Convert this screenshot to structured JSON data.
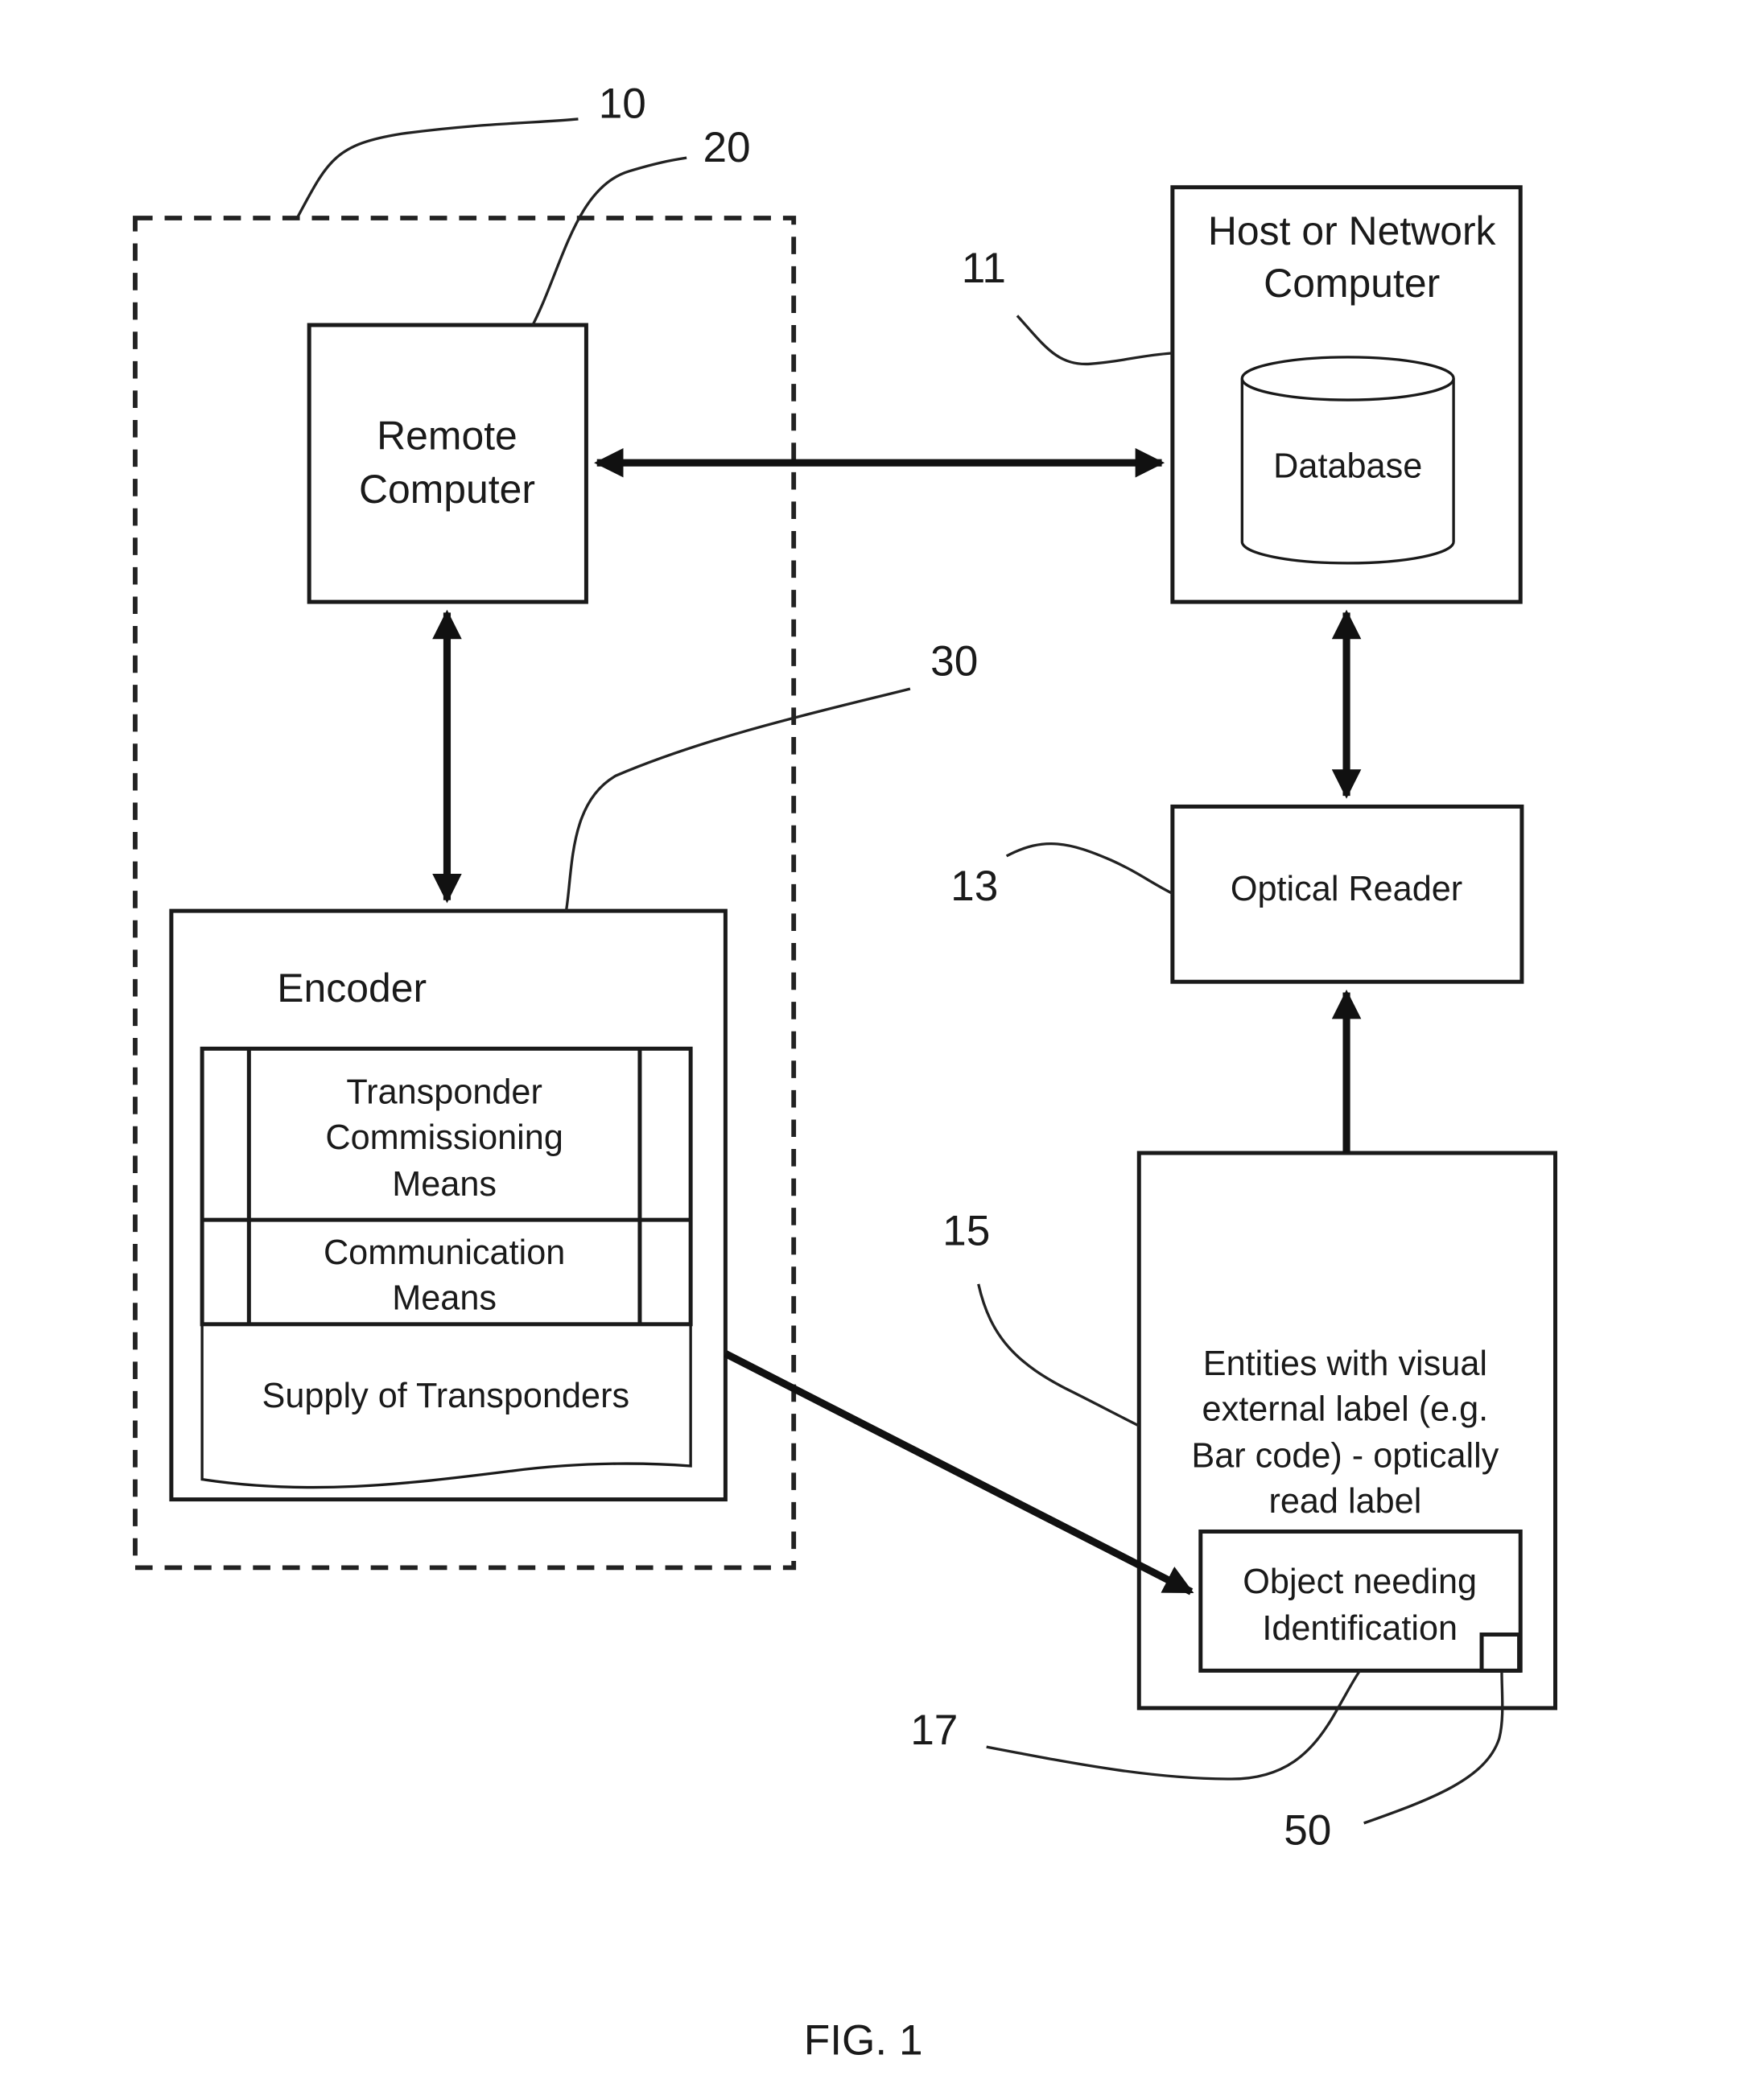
{
  "figure": {
    "caption": "FIG. 1",
    "reference_numerals": {
      "system": "10",
      "remote_computer": "20",
      "host": "11",
      "encoder": "30",
      "optical_reader": "13",
      "entities": "15",
      "object": "17",
      "transponder": "50"
    },
    "blocks": {
      "remote_computer": [
        "Remote",
        "Computer"
      ],
      "host": [
        "Host or Network",
        "Computer"
      ],
      "database": "Database",
      "optical_reader": "Optical Reader",
      "encoder": "Encoder",
      "transponder_commissioning": [
        "Transponder",
        "Commissioning",
        "Means"
      ],
      "communication": [
        "Communication",
        "Means"
      ],
      "supply": "Supply of Transponders",
      "entities": [
        "Entities with visual",
        "external label (e.g.",
        "Bar code) - optically",
        "read label"
      ],
      "object": [
        "Object needing",
        "Identification"
      ]
    }
  }
}
